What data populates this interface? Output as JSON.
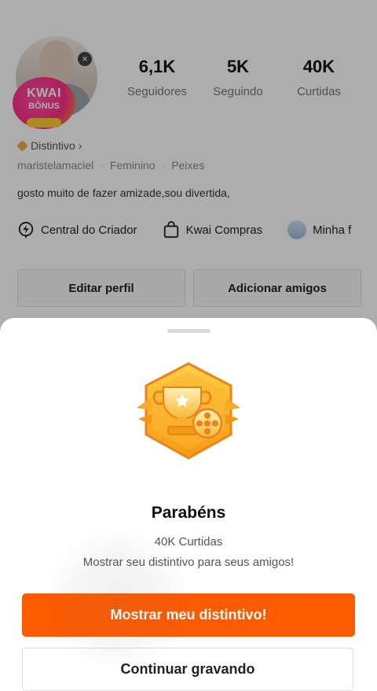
{
  "profile": {
    "kwai_badge": {
      "line1": "KWAI",
      "line2": "BÔNUS"
    },
    "close_glyph": "×",
    "stats": [
      {
        "value": "6,1K",
        "label": "Seguidores"
      },
      {
        "value": "5K",
        "label": "Seguindo"
      },
      {
        "value": "40K",
        "label": "Curtidas"
      }
    ],
    "distintivo": "Distintivo",
    "distintivo_chevron": "›",
    "meta": {
      "username": "maristelamaciel",
      "gender": "Feminino",
      "sign": "Peixes",
      "separator": "·"
    },
    "bio": "gosto muito de fazer amizade,sou divertida,",
    "links": [
      {
        "label": "Central do Criador",
        "icon": "lightning-icon"
      },
      {
        "label": "Kwai Compras",
        "icon": "shopping-bag-icon"
      },
      {
        "label": "Minha f",
        "icon": "thumbnail-icon"
      }
    ],
    "buttons": {
      "edit": "Editar perfil",
      "add_friends": "Adicionar amigos"
    }
  },
  "sheet": {
    "title": "Parabéns",
    "subtitle": "40K Curtidas",
    "description": "Mostrar seu distintivo para seus amigos!",
    "primary_button": "Mostrar meu distintivo!",
    "secondary_button": "Continuar gravando",
    "badge_icon": "trophy-film-badge-icon"
  },
  "colors": {
    "accent": "#fe5a00",
    "badge_gold": "#f5a623",
    "overlay": "rgba(0,0,0,0.32)"
  }
}
